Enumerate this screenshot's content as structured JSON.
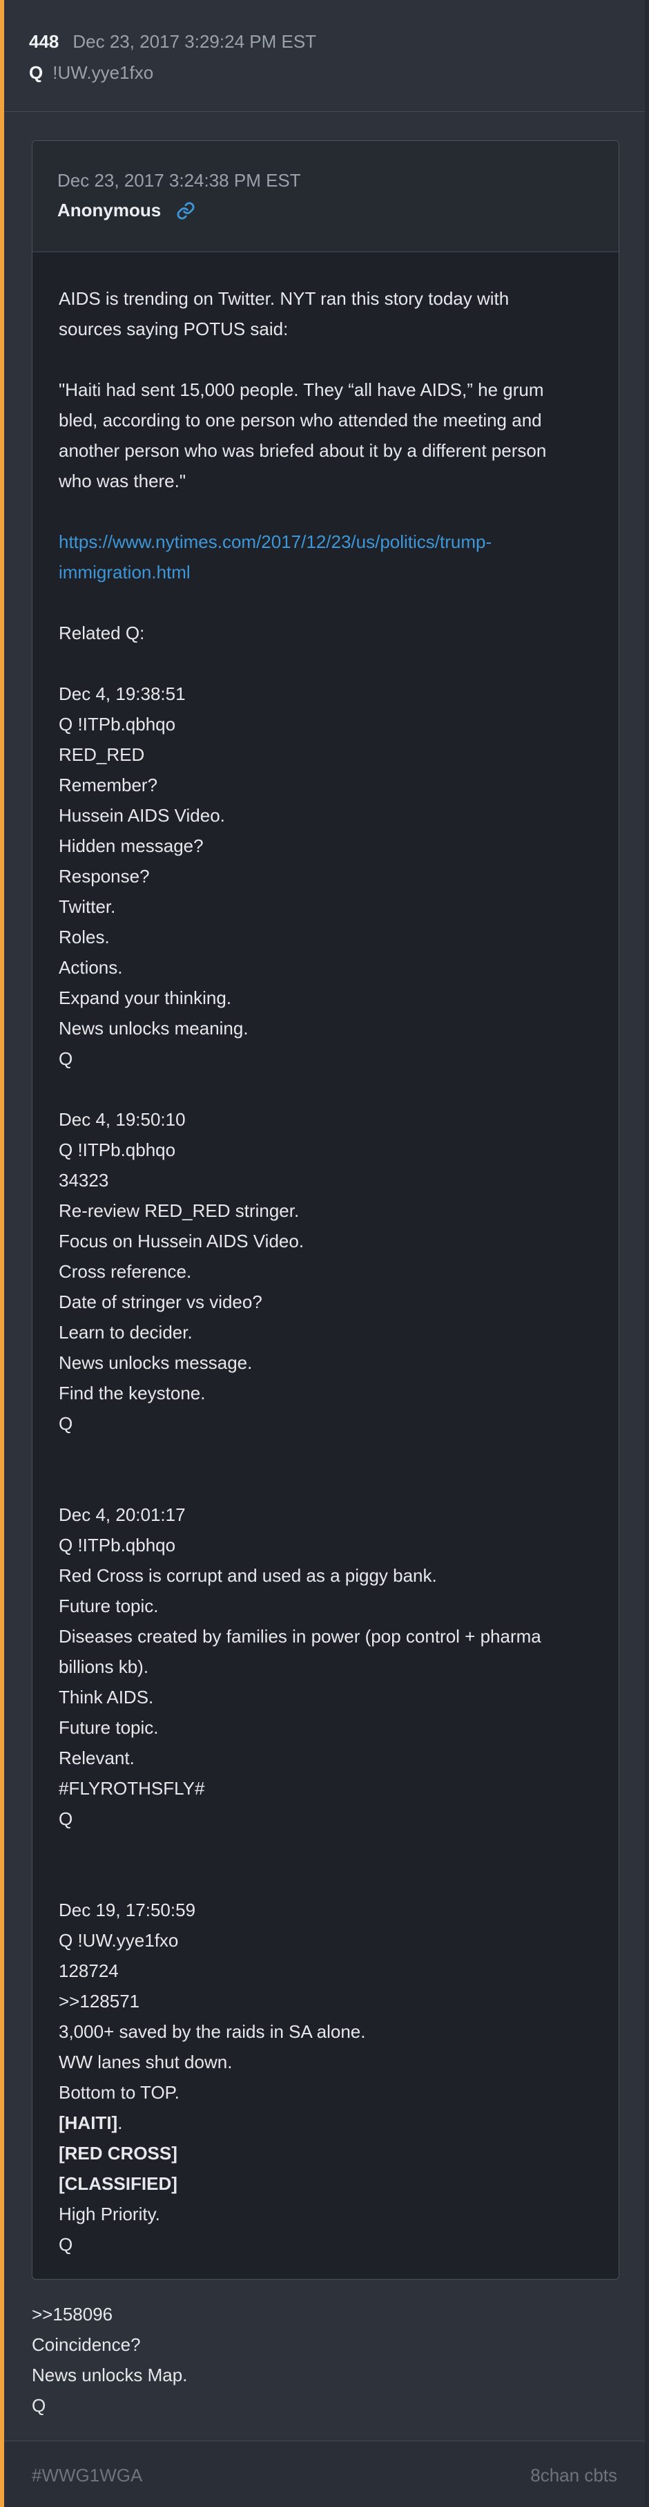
{
  "post": {
    "number": "448",
    "date": "Dec 23, 2017 3:29:24 PM EST",
    "author": "Q",
    "tripcode": "!UW.yye1fxo"
  },
  "quote": {
    "date": "Dec 23, 2017 3:24:38 PM EST",
    "name": "Anonymous",
    "icon": "link-icon",
    "para1": [
      "AIDS is trending on Twitter. NYT ran this story today with",
      "sources saying POTUS said:"
    ],
    "para2": [
      "\"Haiti had sent 15,000 people. They “all have AIDS,” he grum",
      "bled, according to one person who attended the meeting and",
      "another person who was briefed about it by a different person",
      "who was there.\""
    ],
    "link": [
      "https://www.nytimes.com/2017/12/23/us/politics/trump-",
      "immigration.html"
    ],
    "related": "Related Q:",
    "block1": [
      "Dec 4, 19:38:51",
      "Q !ITPb.qbhqo",
      "RED_RED",
      "Remember?",
      "Hussein AIDS Video.",
      "Hidden message?",
      "Response?",
      "Twitter.",
      "Roles.",
      "Actions.",
      "Expand your thinking.",
      "News unlocks meaning.",
      "Q"
    ],
    "block2": [
      "Dec 4, 19:50:10",
      "Q !ITPb.qbhqo",
      "34323",
      "Re-review RED_RED stringer.",
      "Focus on Hussein AIDS Video.",
      "Cross reference.",
      "Date of stringer vs video?",
      "Learn to decider.",
      "News unlocks message.",
      "Find the keystone.",
      "Q"
    ],
    "block3": [
      "Dec 4, 20:01:17",
      "Q !ITPb.qbhqo",
      "Red Cross is corrupt and used as a piggy bank.",
      "Future topic.",
      "Diseases created by families in power (pop control + pharma",
      "billions kb).",
      "Think AIDS.",
      "Future topic.",
      "Relevant.",
      "#FLYROTHSFLY#",
      "Q"
    ],
    "block4": [
      "Dec 19, 17:50:59",
      "Q !UW.yye1fxo",
      "128724",
      ">>128571",
      "3,000+ saved by the raids in SA alone.",
      "WW lanes shut down.",
      "Bottom to TOP."
    ],
    "haiti": "[HAITI]",
    "haiti_after": ".",
    "red_cross": "[RED CROSS]",
    "classified": "[CLASSIFIED]",
    "block4_end": [
      "High Priority.",
      "Q"
    ]
  },
  "body": [
    ">>158096",
    "Coincidence?",
    "News unlocks Map.",
    "Q"
  ],
  "footer": {
    "left": "#WWG1WGA",
    "right": "8chan cbts"
  },
  "colors": {
    "accent": "#f2a33c",
    "link": "#3d97d8"
  }
}
